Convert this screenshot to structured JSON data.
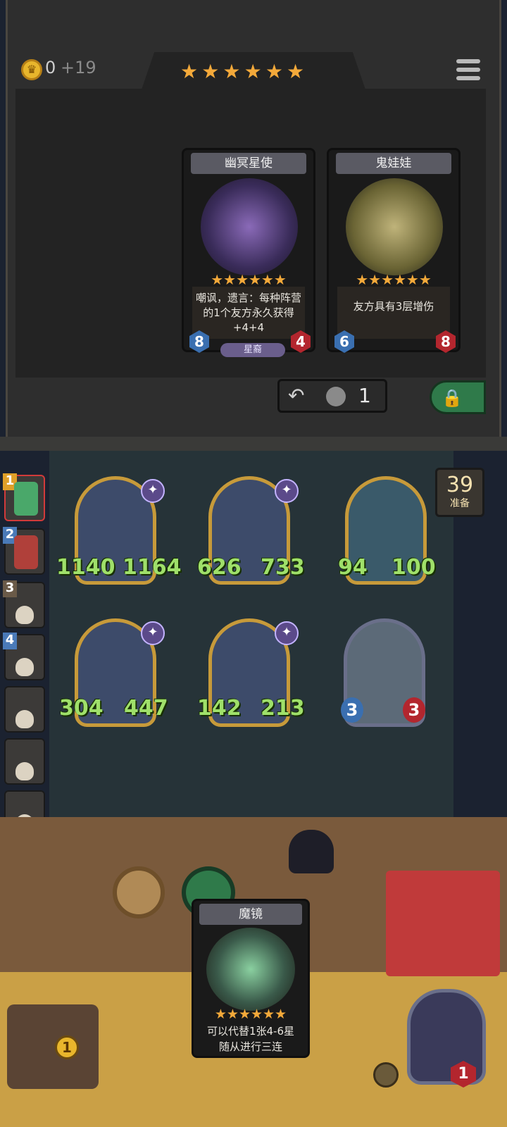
{
  "shop": {
    "gold": "0",
    "gold_income": "+19",
    "tavern_stars": [
      "★",
      "★",
      "★",
      "★",
      "★",
      "★"
    ],
    "cards": [
      {
        "name": "幽冥星使",
        "desc": "嘲讽，遗言：每种阵营的1个友方永久获得+4+4",
        "attack": "8",
        "health": "4",
        "tribe": "星裔",
        "stars": "★★★★★★"
      },
      {
        "name": "鬼娃娃",
        "desc": "友方具有3层增伤",
        "attack": "6",
        "health": "8",
        "tribe": "",
        "stars": "★★★★★★"
      }
    ],
    "refresh_cost": "1"
  },
  "timer": {
    "value": "39",
    "label": "准备"
  },
  "leaderboard": [
    "1",
    "2",
    "3",
    "4",
    "",
    "",
    "",
    ""
  ],
  "board": {
    "row1": [
      {
        "attack": "1140",
        "health": "1164"
      },
      {
        "attack": "626",
        "health": "733"
      },
      {
        "attack": "94",
        "health": "100"
      }
    ],
    "row2": [
      {
        "attack": "304",
        "health": "447"
      },
      {
        "attack": "142",
        "health": "213"
      },
      {
        "attack": "3",
        "health": "3"
      }
    ]
  },
  "hand": {
    "name": "魔镜",
    "desc_line1": "可以代替1张4-6星",
    "desc_line2": "随从进行三连",
    "stars": "★★★★★★"
  },
  "tavern_tier": "1",
  "hero_health": "1",
  "colors": {
    "gold": "#f3a93a",
    "stat_green": "#9fe06a",
    "attack_blue": "#3a6fb0",
    "health_red": "#b3262e"
  }
}
